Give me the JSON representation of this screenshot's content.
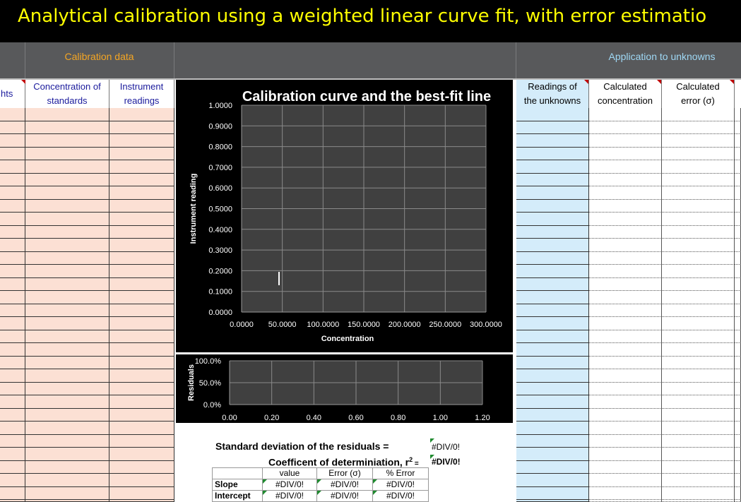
{
  "title": "Analytical calibration using a weighted linear curve fit, with error estimatio",
  "sections": {
    "calibration": "Calibration data",
    "application": "Application to unknowns"
  },
  "columns": {
    "weights_partial": "hts",
    "conc_line1": "Concentration of",
    "conc_line2": "standards",
    "instr_line1": "Instrument",
    "instr_line2": "readings",
    "readings_line1": "Readings of",
    "readings_line2": "the unknowns",
    "calc_conc_line1": "Calculated",
    "calc_conc_line2": "concentration",
    "calc_err_line1": "Calculated",
    "calc_err_line2": "error (σ)"
  },
  "colors": {
    "title": "#ffff00",
    "header_band": "#58595b",
    "calibration_label": "#f5a623",
    "application_label": "#9fd8f5",
    "cal_cells": "#fce0d4",
    "unknown_cells": "#d4ecfa",
    "chart_bg": "#404040",
    "chart_frame": "#000000"
  },
  "chart_data": [
    {
      "type": "scatter",
      "title": "Calibration curve and the best-fit line",
      "xlabel": "Concentration",
      "ylabel": "Instrument reading",
      "xlim": [
        0,
        300
      ],
      "ylim": [
        0,
        1
      ],
      "x_ticks": [
        "0.0000",
        "50.0000",
        "100.0000",
        "150.0000",
        "200.0000",
        "250.0000",
        "300.0000"
      ],
      "y_ticks": [
        "0.0000",
        "0.1000",
        "0.2000",
        "0.3000",
        "0.4000",
        "0.5000",
        "0.6000",
        "0.7000",
        "0.8000",
        "0.9000",
        "1.0000"
      ],
      "grid": true,
      "series": []
    },
    {
      "type": "scatter",
      "title": "",
      "xlabel": "",
      "ylabel": "Residuals",
      "xlim": [
        0,
        1.2
      ],
      "ylim": [
        0,
        1
      ],
      "x_ticks": [
        "0.00",
        "0.20",
        "0.40",
        "0.60",
        "0.80",
        "1.00",
        "1.20"
      ],
      "y_ticks": [
        "0.0%",
        "50.0%",
        "100.0%"
      ],
      "grid": true,
      "series": []
    }
  ],
  "stats": {
    "sd_label": "Standard deviation of the residuals =",
    "sd_value": "#DIV/0!",
    "r2_label": "Coefficent of determiniation, r",
    "r2_sup": "2",
    "r2_eq": " =",
    "r2_value": "#DIV/0!",
    "table": {
      "headers": [
        "",
        "value",
        "Error (σ)",
        "% Error"
      ],
      "rows": [
        {
          "label": "Slope",
          "value": "#DIV/0!",
          "error": "#DIV/0!",
          "pct": "#DIV/0!"
        },
        {
          "label": "Intercept",
          "value": "#DIV/0!",
          "error": "#DIV/0!",
          "pct": "#DIV/0!"
        }
      ]
    }
  }
}
